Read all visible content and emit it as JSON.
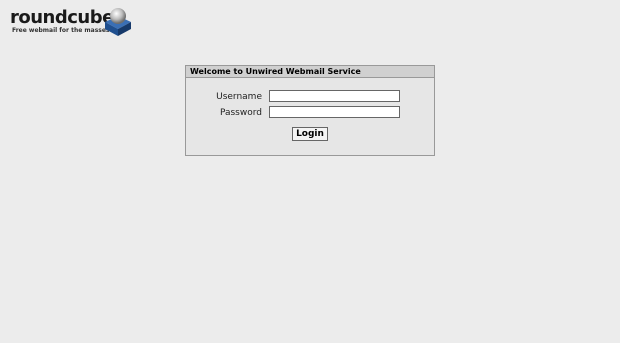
{
  "logo": {
    "wordmark": "roundcube",
    "tagline": "Free webmail for the masses"
  },
  "login": {
    "title": "Welcome to Unwired Webmail Service",
    "username_label": "Username",
    "username_value": "",
    "password_label": "Password",
    "password_value": "",
    "submit_label": "Login"
  },
  "colors": {
    "background": "#ececec",
    "box_background": "#e6e6e6",
    "header_background": "#d0d0d0",
    "border": "#999999",
    "logo_cube": "#1f4f8f"
  },
  "icons": {
    "logo": "roundcube-cube-icon"
  }
}
